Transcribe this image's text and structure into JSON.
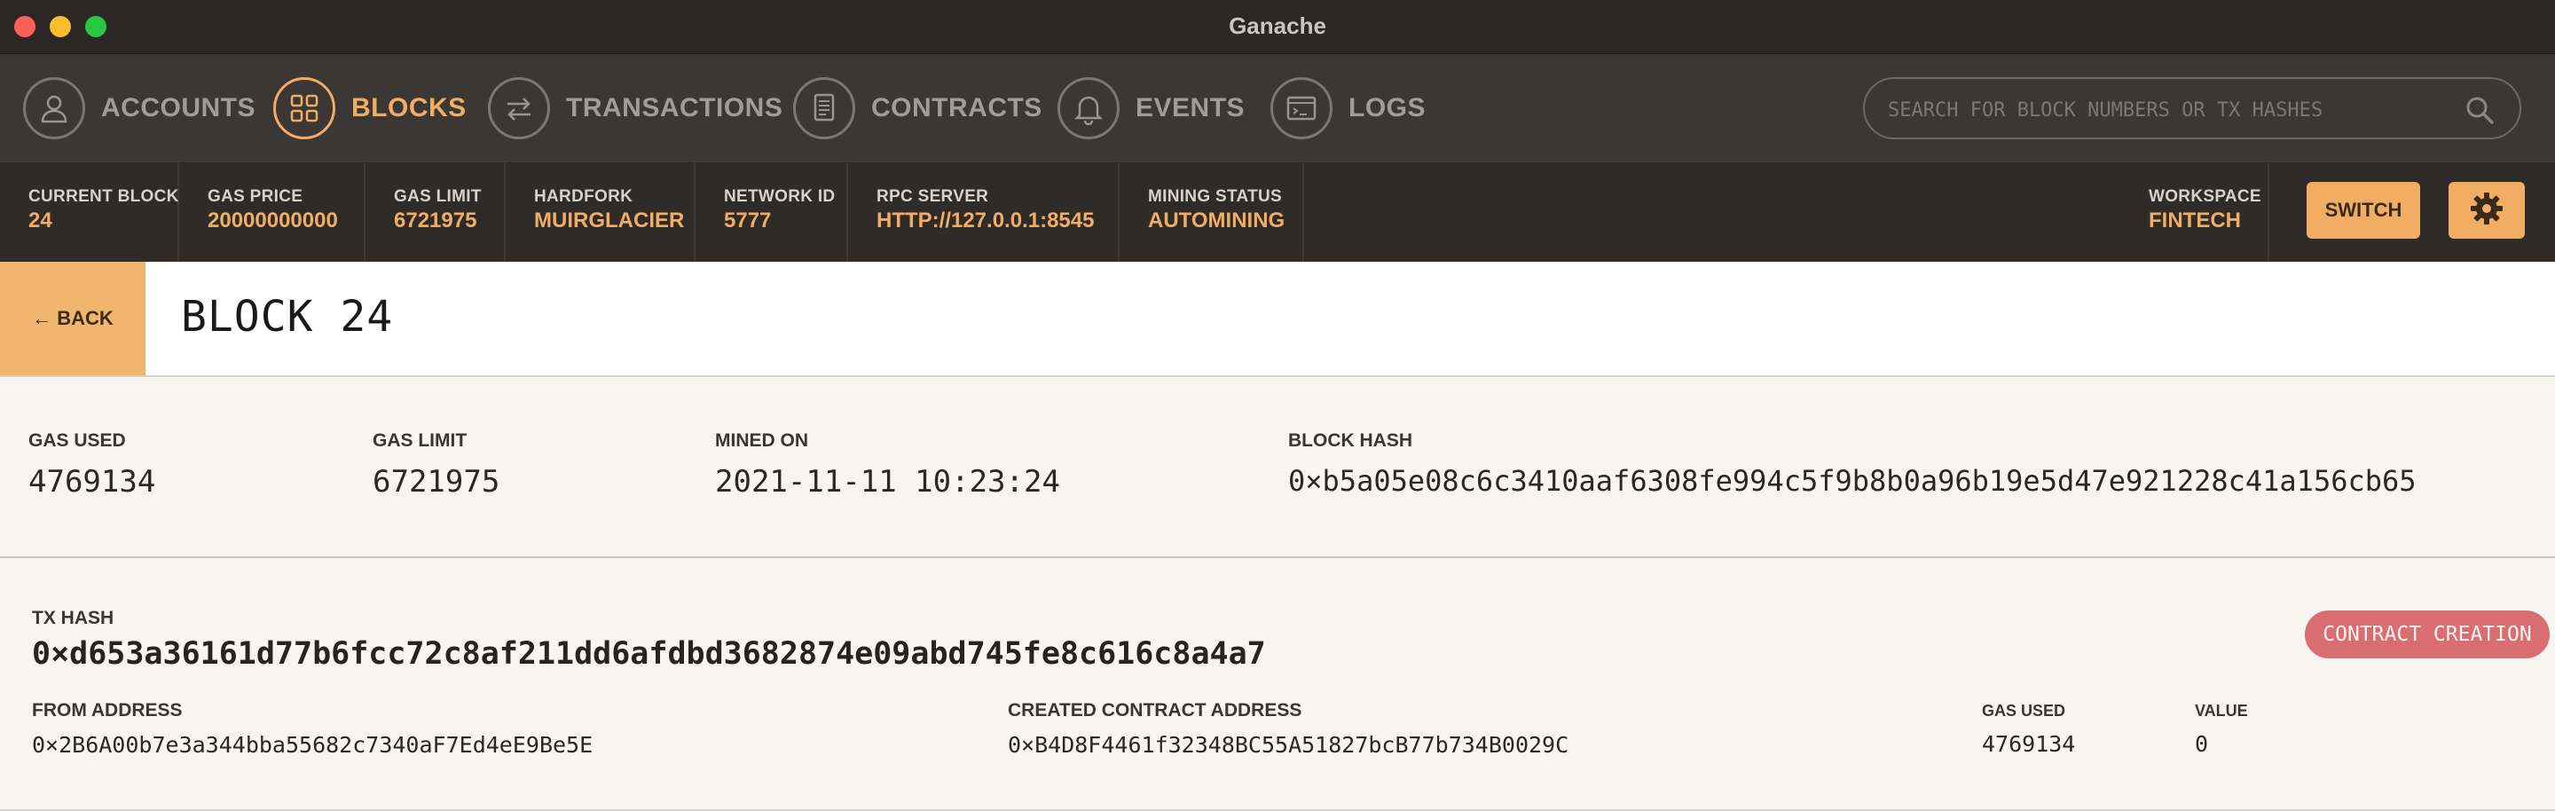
{
  "window": {
    "title": "Ganache"
  },
  "nav": {
    "items": [
      {
        "label": "ACCOUNTS",
        "icon": "user-icon",
        "active": false
      },
      {
        "label": "BLOCKS",
        "icon": "grid-icon",
        "active": true
      },
      {
        "label": "TRANSACTIONS",
        "icon": "swap-arrows-icon",
        "active": false
      },
      {
        "label": "CONTRACTS",
        "icon": "document-icon",
        "active": false
      },
      {
        "label": "EVENTS",
        "icon": "bell-icon",
        "active": false
      },
      {
        "label": "LOGS",
        "icon": "terminal-icon",
        "active": false
      }
    ],
    "search_placeholder": "SEARCH FOR BLOCK NUMBERS OR TX HASHES"
  },
  "status": {
    "current_block": {
      "label": "CURRENT BLOCK",
      "value": "24"
    },
    "gas_price": {
      "label": "GAS PRICE",
      "value": "20000000000"
    },
    "gas_limit": {
      "label": "GAS LIMIT",
      "value": "6721975"
    },
    "hardfork": {
      "label": "HARDFORK",
      "value": "MUIRGLACIER"
    },
    "network_id": {
      "label": "NETWORK ID",
      "value": "5777"
    },
    "rpc_server": {
      "label": "RPC SERVER",
      "value": "HTTP://127.0.0.1:8545"
    },
    "mining_status": {
      "label": "MINING STATUS",
      "value": "AUTOMINING"
    },
    "workspace": {
      "label": "WORKSPACE",
      "value": "FINTECH"
    },
    "switch_label": "SWITCH"
  },
  "header": {
    "back_label": "← BACK",
    "title": "BLOCK 24"
  },
  "block": {
    "gas_used": {
      "label": "GAS USED",
      "value": "4769134"
    },
    "gas_limit": {
      "label": "GAS LIMIT",
      "value": "6721975"
    },
    "mined_on": {
      "label": "MINED ON",
      "value": "2021-11-11 10:23:24"
    },
    "block_hash": {
      "label": "BLOCK HASH",
      "value": "0×b5a05e08c6c3410aaf6308fe994c5f9b8b0a96b19e5d47e921228c41a156cb65"
    }
  },
  "transaction": {
    "hash_label": "TX HASH",
    "hash": "0×d653a36161d77b6fcc72c8af211dd6afdbd3682874e09abd745fe8c616c8a4a7",
    "type_badge": "CONTRACT CREATION",
    "from_address": {
      "label": "FROM ADDRESS",
      "value": "0×2B6A00b7e3a344bba55682c7340aF7Ed4eE9Be5E"
    },
    "created_contract_address": {
      "label": "CREATED CONTRACT ADDRESS",
      "value": "0×B4D8F4461f32348BC55A51827bcB77b734B0029C"
    },
    "gas_used": {
      "label": "GAS USED",
      "value": "4769134"
    },
    "value": {
      "label": "VALUE",
      "value": "0"
    }
  },
  "colors": {
    "accent": "#f1ad63",
    "titlebar": "#2a2726",
    "nav_bg": "#3b3735",
    "status_bg": "#2f2b29",
    "badge": "#d96e72"
  }
}
